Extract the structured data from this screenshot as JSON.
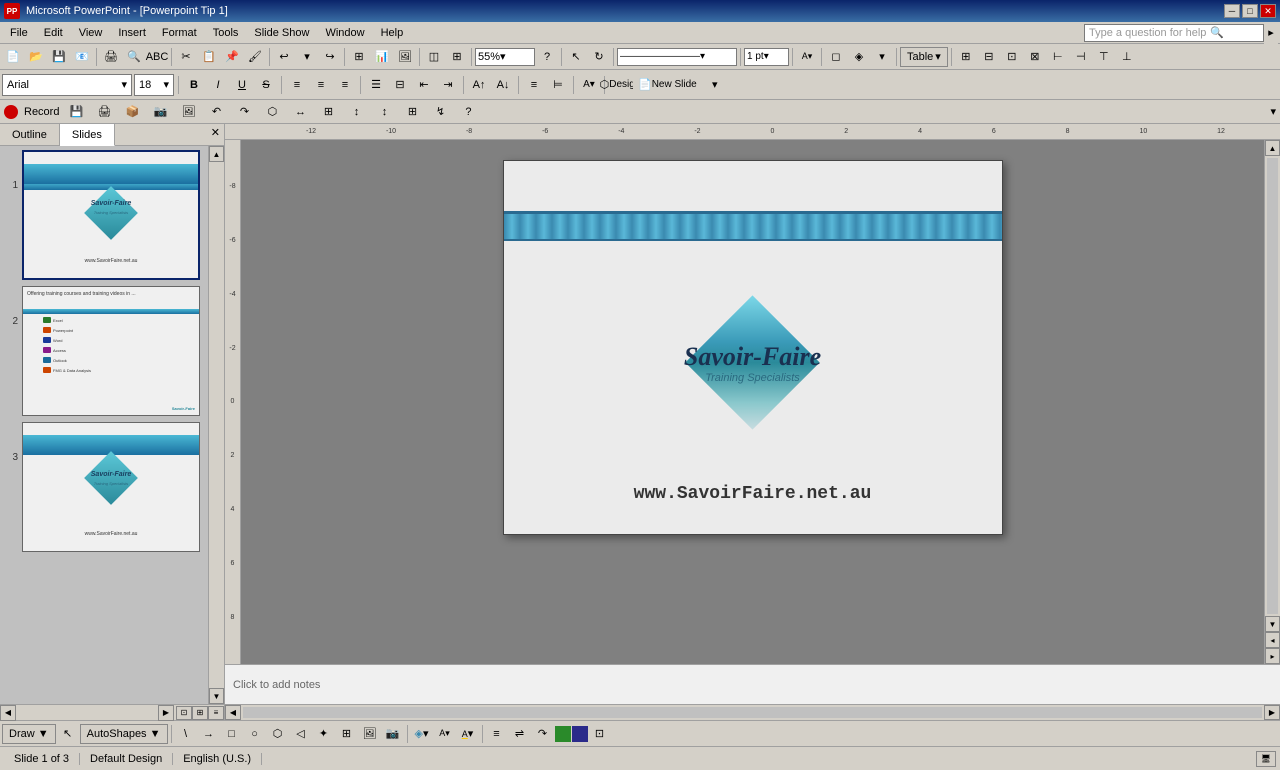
{
  "app": {
    "title": "Microsoft PowerPoint - [Powerpoint Tip 1]",
    "icon": "PP"
  },
  "title_bar": {
    "controls": [
      "─",
      "□",
      "✕"
    ]
  },
  "menu": {
    "items": [
      "File",
      "Edit",
      "View",
      "Insert",
      "Format",
      "Tools",
      "Slide Show",
      "Window",
      "Help"
    ],
    "question_placeholder": "Type a question for help"
  },
  "toolbar_main": {
    "zoom": "55%",
    "line_style": "————————",
    "line_pt": "1 pt",
    "table_label": "Table"
  },
  "format_toolbar": {
    "font": "Arial",
    "size": "18",
    "bold": "B",
    "italic": "I",
    "underline": "U",
    "strikethrough": "S",
    "align_left": "≡",
    "align_center": "≡",
    "align_right": "≡",
    "design_label": "Design",
    "new_slide_label": "New Slide"
  },
  "record_bar": {
    "label": "Record"
  },
  "tabs": {
    "outline": "Outline",
    "slides": "Slides"
  },
  "slides": [
    {
      "number": "1",
      "type": "title",
      "selected": true
    },
    {
      "number": "2",
      "type": "content",
      "selected": false,
      "title": "Offering training courses and training videos in ..."
    },
    {
      "number": "3",
      "type": "title",
      "selected": false
    }
  ],
  "slide1": {
    "logo_name": "Savoir-Faire",
    "logo_sub": "Training Specialists",
    "url": "www.SavoirFaire.net.au"
  },
  "notes": {
    "placeholder": "Click to add notes"
  },
  "status": {
    "slide_info": "Slide 1 of 3",
    "design": "Default Design",
    "language": "English (U.S.)"
  },
  "draw_toolbar": {
    "draw_label": "Draw ▼",
    "autoshapes_label": "AutoShapes ▼"
  },
  "ruler": {
    "marks": [
      "-12",
      "-10",
      "-8",
      "-6",
      "-4",
      "-2",
      "0",
      "2",
      "4",
      "6",
      "8",
      "10",
      "12"
    ]
  }
}
